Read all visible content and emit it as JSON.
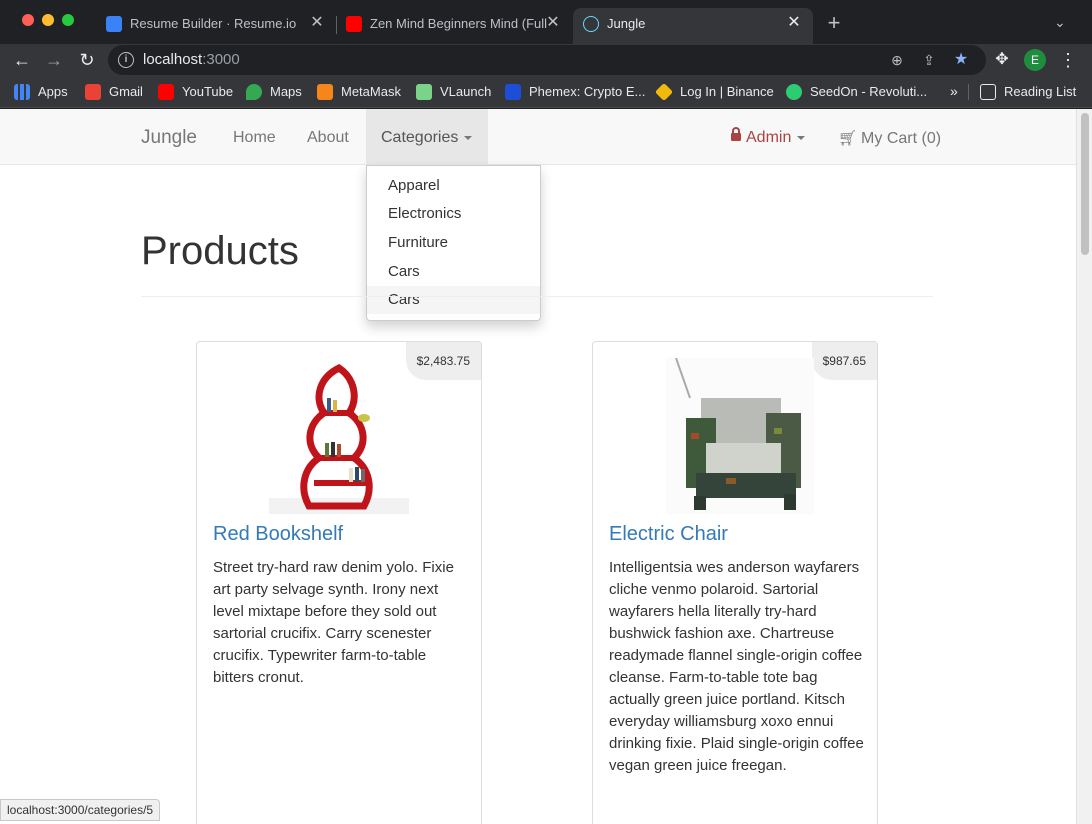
{
  "tabs": [
    {
      "title": "Resume Builder · Resume.io",
      "active": false
    },
    {
      "title": "Zen Mind Beginners Mind (Full",
      "active": false
    },
    {
      "title": "Jungle",
      "active": true
    }
  ],
  "address_bar": {
    "host": "localhost",
    "port": ":3000"
  },
  "profile_initial": "E",
  "bookmarks": [
    {
      "label": "Apps",
      "color": "#4285f4"
    },
    {
      "label": "Gmail",
      "color": "#ea4335"
    },
    {
      "label": "YouTube",
      "color": "#ff0000"
    },
    {
      "label": "Maps",
      "color": "#34a853"
    },
    {
      "label": "MetaMask",
      "color": "#f6851b"
    },
    {
      "label": "VLaunch",
      "color": "#7bd389"
    },
    {
      "label": "Phemex: Crypto E...",
      "color": "#1d4ed8"
    },
    {
      "label": "Log In | Binance",
      "color": "#f0b90b"
    },
    {
      "label": "SeedOn - Revoluti...",
      "color": "#2ecc71"
    }
  ],
  "bookmarks_more": "»",
  "reading_list": "Reading List",
  "navbar": {
    "brand": "Jungle",
    "home": "Home",
    "about": "About",
    "categories": "Categories",
    "admin": "Admin",
    "cart": "My Cart (0)"
  },
  "categories_menu": [
    "Apparel",
    "Electronics",
    "Furniture",
    "Cars",
    "Cars"
  ],
  "page": {
    "heading": "Products"
  },
  "products": [
    {
      "price": "$2,483.75",
      "name": "Red Bookshelf",
      "description": "Street try-hard raw denim yolo. Fixie art party selvage synth. Irony next level mixtape before they sold out sartorial crucifix. Carry scenester crucifix. Typewriter farm-to-table bitters cronut."
    },
    {
      "price": "$987.65",
      "name": "Electric Chair",
      "description": "Intelligentsia wes anderson wayfarers cliche venmo polaroid. Sartorial wayfarers hella literally try-hard bushwick fashion axe. Chartreuse readymade flannel single-origin coffee cleanse. Farm-to-table tote bag actually green juice portland. Kitsch everyday williamsburg xoxo ennui drinking fixie. Plaid single-origin coffee vegan green juice freegan."
    }
  ],
  "status_bar": "localhost:3000/categories/5",
  "colors": {
    "link": "#337ab7",
    "admin": "#a94442",
    "navbar_bg": "#f8f8f8"
  }
}
